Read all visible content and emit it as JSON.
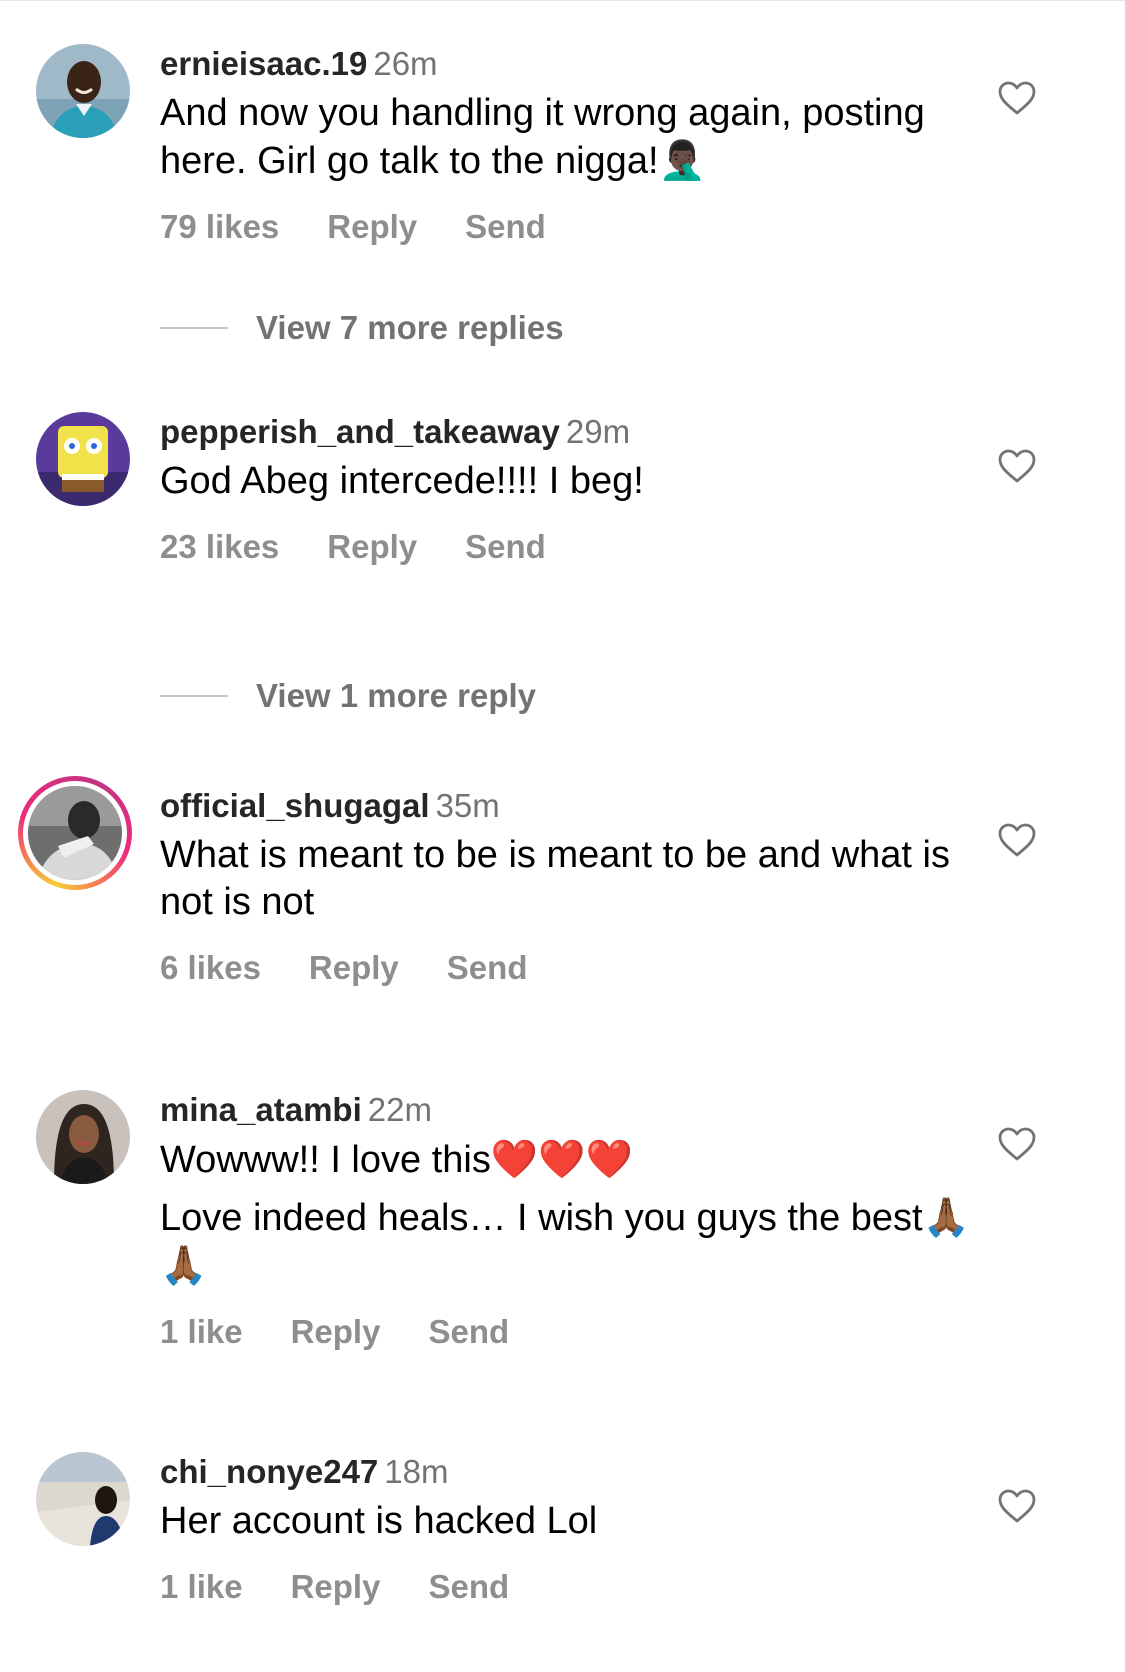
{
  "comments": [
    {
      "username": "ernieisaac.19",
      "time": "26m",
      "text": "And now you handling it wrong again, posting here. Girl go talk to the nigga!",
      "emoji": "🤦🏿‍♂️",
      "likes": "79 likes",
      "reply": "Reply",
      "send": "Send",
      "view_replies": "View 7 more replies"
    },
    {
      "username": "pepperish_and_takeaway",
      "time": "29m",
      "text": "God Abeg intercede!!!! I beg!",
      "likes": "23 likes",
      "reply": "Reply",
      "send": "Send",
      "view_replies": "View 1 more reply"
    },
    {
      "username": "official_shugagal",
      "time": "35m",
      "text": "What is meant to be is meant to be and what is not is not",
      "likes": "6 likes",
      "reply": "Reply",
      "send": "Send"
    },
    {
      "username": "mina_atambi",
      "time": "22m",
      "line1": "Wowww!! I love this",
      "line1_emoji": "❤️❤️❤️",
      "line2": "Love indeed heals… I wish you guys the best",
      "line2_emoji": "🙏🏾🙏🏾",
      "likes": "1 like",
      "reply": "Reply",
      "send": "Send"
    },
    {
      "username": "chi_nonye247",
      "time": "18m",
      "text": "Her account is hacked Lol",
      "likes": "1 like",
      "reply": "Reply",
      "send": "Send"
    }
  ],
  "icons": {
    "like": "heart-outline-icon"
  },
  "colors": {
    "username": "#262626",
    "meta": "#737373",
    "actions": "#8e8e8e",
    "story_ring": "#ee2a7b"
  }
}
